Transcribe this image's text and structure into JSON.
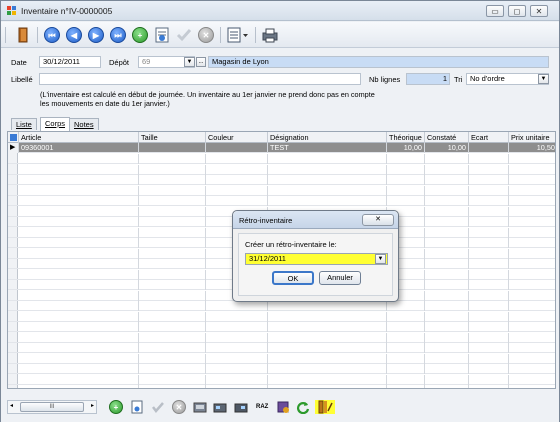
{
  "window": {
    "title": "Inventaire n°IV-0000005",
    "controls": {
      "minimize": "▭",
      "restore": "◻",
      "close": "✕"
    }
  },
  "toolbar": {
    "icons": [
      "exit-icon",
      "first-record-icon",
      "previous-record-icon",
      "next-record-icon",
      "last-record-icon",
      "add-record-icon",
      "edit-record-icon",
      "validate-icon",
      "delete-icon",
      "list-menu-icon",
      "print-icon"
    ]
  },
  "form": {
    "date_label": "Date",
    "date_value": "30/12/2011",
    "depot_label": "Dépôt",
    "depot_code": "69",
    "depot_button": "...",
    "depot_name": "Magasin de Lyon",
    "libelle_label": "Libellé",
    "libelle_value": "",
    "nb_lignes_label": "Nb lignes",
    "nb_lignes_value": "1",
    "tri_label": "Tri",
    "tri_value": "No d'ordre",
    "note_line1": "(L'inventaire est calculé en début de journée. Un inventaire au 1er janvier ne prend donc pas en compte",
    "note_line2": "les mouvements en date du 1er janvier.)"
  },
  "tabs": [
    {
      "label": "Liste"
    },
    {
      "label": "Corps"
    },
    {
      "label": "Notes"
    }
  ],
  "grid": {
    "columns": [
      "Article",
      "Taille",
      "Couleur",
      "Désignation",
      "Théorique",
      "Constaté",
      "Ecart",
      "Prix unitaire"
    ],
    "rows": [
      {
        "article": "09360001",
        "taille": "",
        "couleur": "",
        "designation": "TEST",
        "theorique": "10,00",
        "constate": "10,00",
        "ecart": "",
        "prix": "10,50"
      }
    ]
  },
  "bottombar": {
    "scroll_label": "III",
    "raz_label": "RAZ"
  },
  "dialog": {
    "title": "Rétro-inventaire",
    "close": "✕",
    "prompt": "Créer un rétro-inventaire le:",
    "date_value": "31/12/2011",
    "ok_label": "OK",
    "cancel_label": "Annuler"
  },
  "colors": {
    "accent_blue": "#c8dcf5",
    "selected_row": "#8e8e8e",
    "highlight": "#ffff00"
  }
}
